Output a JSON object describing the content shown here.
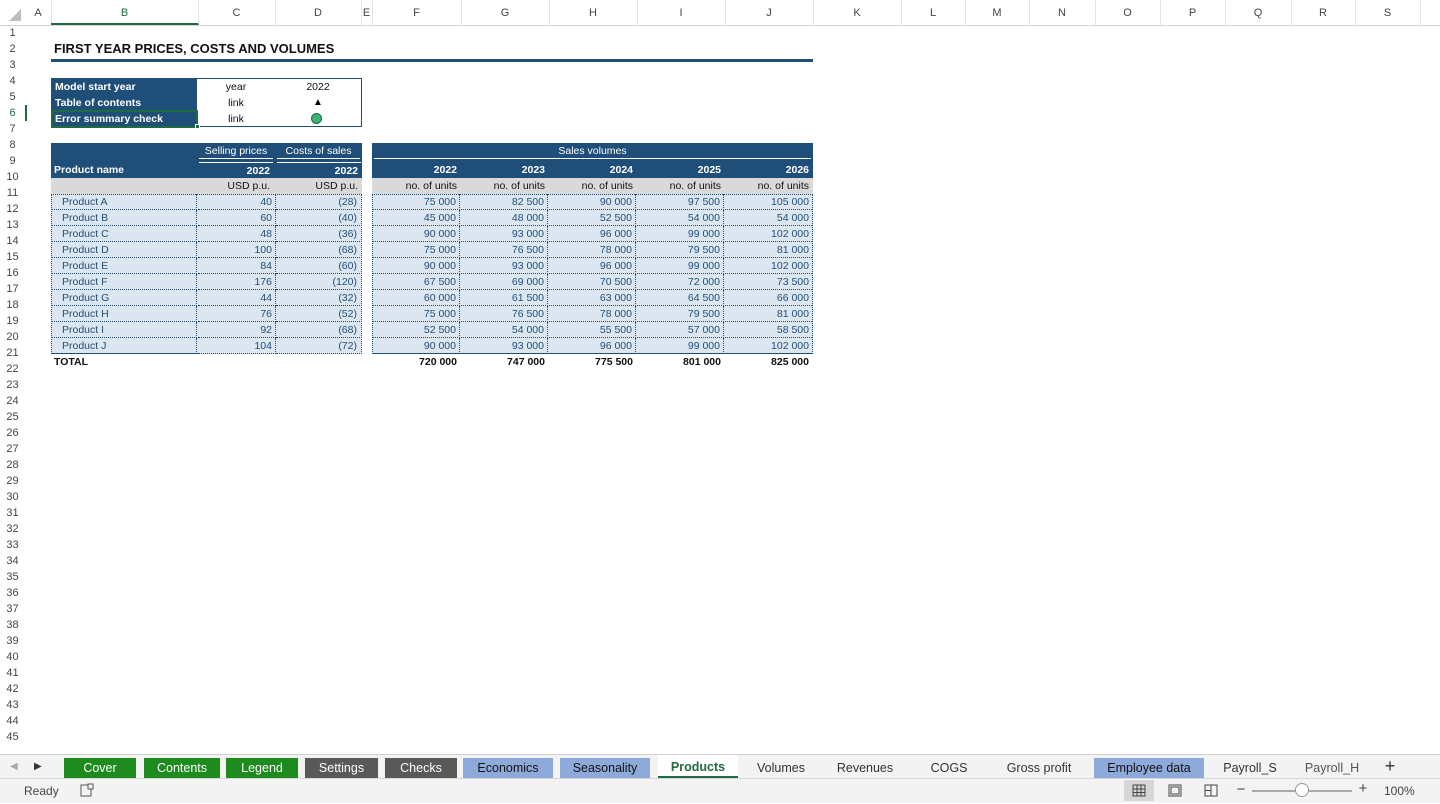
{
  "columns": [
    "A",
    "B",
    "C",
    "D",
    "E",
    "F",
    "G",
    "H",
    "I",
    "J",
    "K",
    "L",
    "M",
    "N",
    "O",
    "P",
    "Q",
    "R",
    "S"
  ],
  "rows": [
    "1",
    "2",
    "3",
    "4",
    "5",
    "6",
    "7",
    "8",
    "9",
    "10",
    "11",
    "12",
    "13",
    "14",
    "15",
    "16",
    "17",
    "18",
    "19",
    "20",
    "21",
    "22",
    "23",
    "24",
    "25",
    "26",
    "27",
    "28",
    "29",
    "30",
    "31",
    "32",
    "33",
    "34",
    "35",
    "36",
    "37",
    "38",
    "39",
    "40",
    "41",
    "42",
    "43",
    "44",
    "45"
  ],
  "title": "FIRST YEAR PRICES, COSTS AND VOLUMES",
  "info": {
    "start_label": "Model start year",
    "start_unit": "year",
    "start_value": "2022",
    "toc_label": "Table of contents",
    "toc_unit": "link",
    "toc_icon": "▲",
    "err_label": "Error summary check",
    "err_unit": "link",
    "err_color": "#3cb371"
  },
  "table": {
    "hdr_selling": "Selling prices",
    "hdr_costs": "Costs of sales",
    "hdr_volumes": "Sales volumes",
    "product_name": "Product name",
    "years": [
      "2022",
      "2022",
      "2022",
      "2023",
      "2024",
      "2025",
      "2026"
    ],
    "units": [
      "USD p.u.",
      "USD p.u.",
      "no. of units",
      "no. of units",
      "no. of units",
      "no. of units",
      "no. of units"
    ],
    "rows": [
      {
        "name": "Product A",
        "price": "40",
        "cost": "(28)",
        "v": [
          "75 000",
          "82 500",
          "90 000",
          "97 500",
          "105 000"
        ]
      },
      {
        "name": "Product B",
        "price": "60",
        "cost": "(40)",
        "v": [
          "45 000",
          "48 000",
          "52 500",
          "54 000",
          "54 000"
        ]
      },
      {
        "name": "Product C",
        "price": "48",
        "cost": "(36)",
        "v": [
          "90 000",
          "93 000",
          "96 000",
          "99 000",
          "102 000"
        ]
      },
      {
        "name": "Product D",
        "price": "100",
        "cost": "(68)",
        "v": [
          "75 000",
          "76 500",
          "78 000",
          "79 500",
          "81 000"
        ]
      },
      {
        "name": "Product E",
        "price": "84",
        "cost": "(60)",
        "v": [
          "90 000",
          "93 000",
          "96 000",
          "99 000",
          "102 000"
        ]
      },
      {
        "name": "Product F",
        "price": "176",
        "cost": "(120)",
        "v": [
          "67 500",
          "69 000",
          "70 500",
          "72 000",
          "73 500"
        ]
      },
      {
        "name": "Product G",
        "price": "44",
        "cost": "(32)",
        "v": [
          "60 000",
          "61 500",
          "63 000",
          "64 500",
          "66 000"
        ]
      },
      {
        "name": "Product H",
        "price": "76",
        "cost": "(52)",
        "v": [
          "75 000",
          "76 500",
          "78 000",
          "79 500",
          "81 000"
        ]
      },
      {
        "name": "Product I",
        "price": "92",
        "cost": "(68)",
        "v": [
          "52 500",
          "54 000",
          "55 500",
          "57 000",
          "58 500"
        ]
      },
      {
        "name": "Product J",
        "price": "104",
        "cost": "(72)",
        "v": [
          "90 000",
          "93 000",
          "96 000",
          "99 000",
          "102 000"
        ]
      }
    ],
    "total_label": "TOTAL",
    "totals": [
      "720 000",
      "747 000",
      "775 500",
      "801 000",
      "825 000"
    ]
  },
  "sheet_tabs": [
    {
      "label": "Cover",
      "bg": "#1e8b1e",
      "fg": "#ffffff"
    },
    {
      "label": "Contents",
      "bg": "#1e8b1e",
      "fg": "#ffffff"
    },
    {
      "label": "Legend",
      "bg": "#1e8b1e",
      "fg": "#ffffff"
    },
    {
      "label": "Settings",
      "bg": "#595959",
      "fg": "#ffffff"
    },
    {
      "label": "Checks",
      "bg": "#595959",
      "fg": "#ffffff"
    },
    {
      "label": "Economics",
      "bg": "#8eaadb",
      "fg": "#111111"
    },
    {
      "label": "Seasonality",
      "bg": "#8eaadb",
      "fg": "#111111"
    },
    {
      "label": "Products",
      "bg": "#ffffff",
      "fg": "#1d6b3e",
      "active": true
    },
    {
      "label": "Volumes",
      "bg": "",
      "fg": "#333333"
    },
    {
      "label": "Revenues",
      "bg": "",
      "fg": "#333333"
    },
    {
      "label": "COGS",
      "bg": "",
      "fg": "#333333"
    },
    {
      "label": "Gross profit",
      "bg": "",
      "fg": "#333333"
    },
    {
      "label": "Employee data",
      "bg": "#8eaadb",
      "fg": "#111111"
    },
    {
      "label": "Payroll_S",
      "bg": "",
      "fg": "#333333"
    },
    {
      "label": "Payroll_H",
      "bg": "",
      "fg": "#555555"
    }
  ],
  "status": {
    "ready": "Ready",
    "zoom": "100%",
    "zoom_level": 0.5
  }
}
